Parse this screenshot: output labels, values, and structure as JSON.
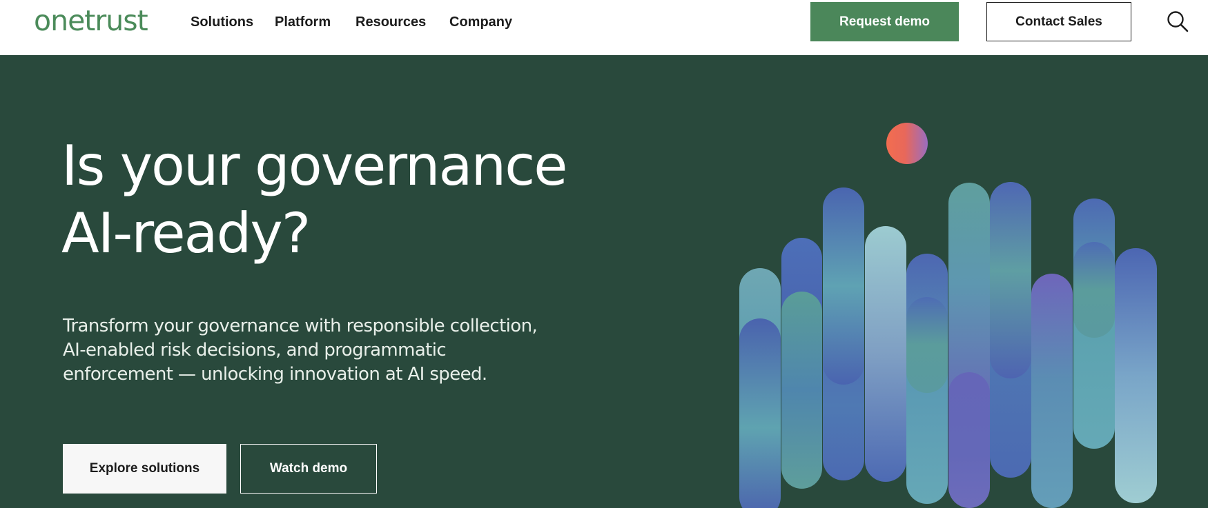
{
  "brand": {
    "logo_text": "onetrust",
    "logo_color": "#4b8b5a"
  },
  "nav": {
    "items": [
      "Solutions",
      "Platform",
      "Resources",
      "Company"
    ]
  },
  "header_actions": {
    "request_demo_label": "Request demo",
    "contact_sales_label": "Contact Sales",
    "search_icon": "search-icon"
  },
  "hero": {
    "background": "#29493c",
    "headline_line1": "Is your governance",
    "headline_line2": "AI-ready?",
    "subtext_line1": "Transform your governance with responsible collection,",
    "subtext_line2": "AI-enabled risk decisions, and programmatic",
    "subtext_line3": "enforcement — unlocking innovation at AI speed.",
    "primary_cta": "Explore solutions",
    "secondary_cta": "Watch demo"
  },
  "colors": {
    "accent_green": "#4b875a",
    "hero_dark_green": "#29493c",
    "illustration_blue": "#4a65b0",
    "illustration_teal": "#5e9fa0",
    "illustration_purple": "#6a64b8",
    "illustration_sphere": "#e8685a"
  }
}
